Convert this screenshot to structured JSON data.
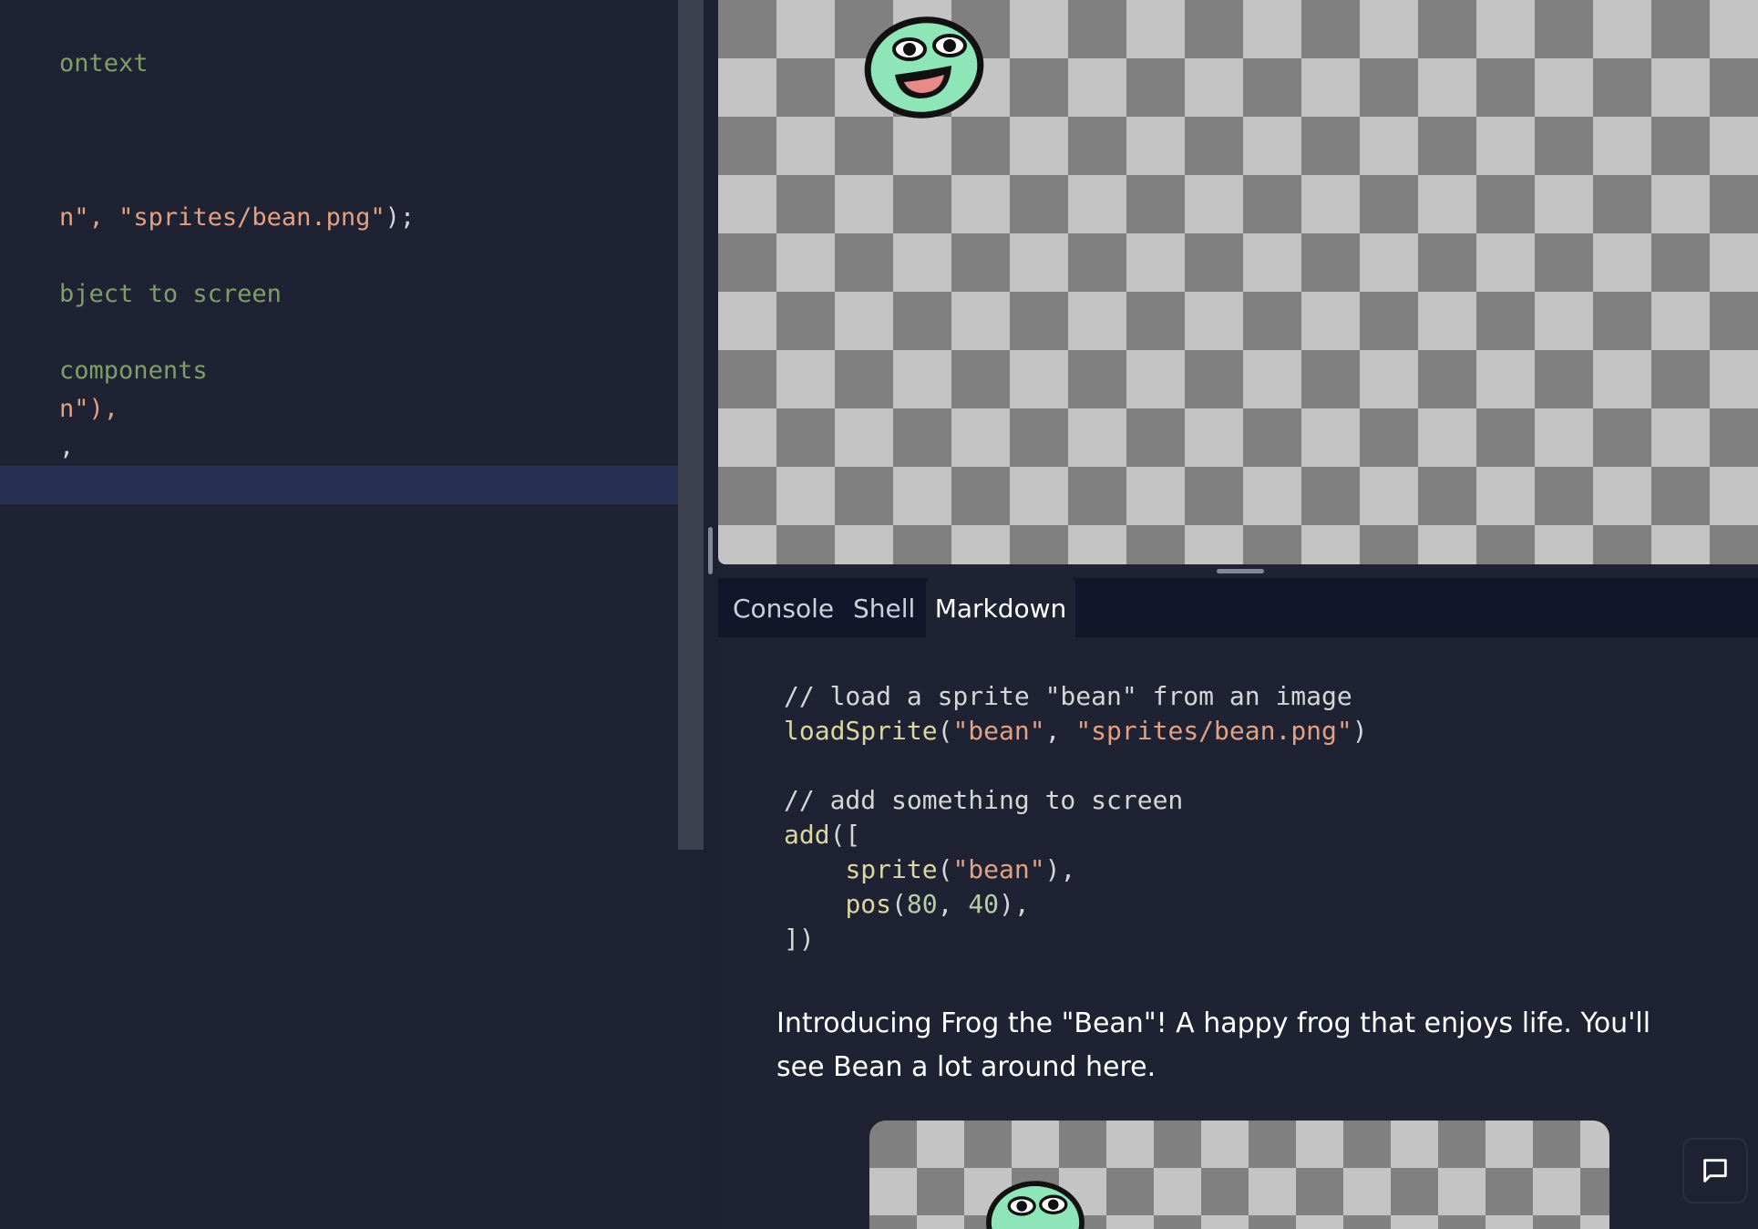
{
  "editor": {
    "lines": [
      {
        "type": "comment",
        "text": "ontext"
      },
      {
        "type": "mixed",
        "a": "n\", ",
        "b": "\"sprites/bean.png\"",
        "c": ");"
      },
      {
        "type": "comment",
        "text": "bject to screen"
      },
      {
        "type": "comment",
        "text": "components"
      },
      {
        "type": "plain",
        "text": "n\"),"
      },
      {
        "type": "plain",
        "text": ","
      }
    ]
  },
  "tabs": [
    {
      "label": "Console",
      "active": false
    },
    {
      "label": "Shell",
      "active": false
    },
    {
      "label": "Markdown",
      "active": true
    }
  ],
  "markdown": {
    "code": {
      "comment1": "// load a sprite \"bean\" from an image",
      "fn1": "loadSprite",
      "arg1a": "\"bean\"",
      "arg1b": "\"sprites/bean.png\"",
      "comment2": "// add something to screen",
      "fn2": "add",
      "fn3": "sprite",
      "arg3": "\"bean\"",
      "fn4": "pos",
      "num1": "80",
      "num2": "40"
    },
    "paragraph": "Introducing Frog the \"Bean\"! A happy frog that enjoys life. You'll see Bean a lot around here."
  },
  "icons": {
    "sprite": "bean-frog-sprite",
    "feedback": "chat-bubble-icon"
  },
  "colors": {
    "background": "#1e2232",
    "checker_dark": "#808080",
    "checker_light": "#c4c4c4",
    "bean_green": "#8ee6b8"
  }
}
